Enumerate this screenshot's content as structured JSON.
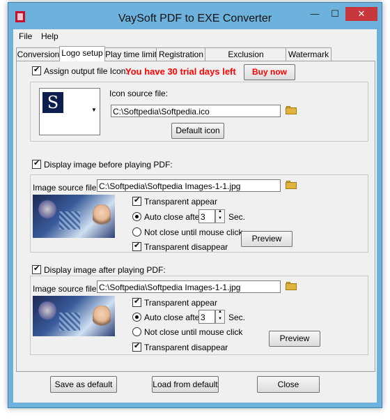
{
  "window": {
    "title": "VaySoft PDF to EXE Converter",
    "minimize": "—",
    "maximize": "☐",
    "close": "✕"
  },
  "menu": [
    "File",
    "Help"
  ],
  "tabs": [
    "Conversion",
    "Logo setup",
    "Play time limit",
    "Registration",
    "Exclusion applications",
    "Watermark"
  ],
  "logo": {
    "assign_icon_label": "Assign output file Icon:",
    "trial_text": "You have 30 trial days left",
    "buy_now": "Buy now",
    "icon_letter": "S",
    "icon_source_label": "Icon source file:",
    "icon_source_value": "C:\\Softpedia\\Softpedia.ico",
    "default_icon": "Default icon",
    "accent_color": "#ff0000"
  },
  "before": {
    "display_label": "Display image before playing PDF:",
    "image_source_label": "Image source file:",
    "image_source_value": "C:\\Softpedia\\Softpedia Images-1-1.jpg",
    "transparent_appear": "Transparent appear",
    "auto_close": "Auto close after",
    "auto_close_value": "3",
    "sec": "Sec.",
    "not_close": "Not close until mouse click",
    "transparent_disappear": "Transparent disappear",
    "preview": "Preview"
  },
  "after": {
    "display_label": "Display image after playing PDF:",
    "image_source_label": "Image source file:",
    "image_source_value": "C:\\Softpedia\\Softpedia Images-1-1.jpg",
    "transparent_appear": "Transparent appear",
    "auto_close": "Auto close after",
    "auto_close_value": "3",
    "sec": "Sec.",
    "not_close": "Not close until mouse click",
    "transparent_disappear": "Transparent disappear",
    "preview": "Preview"
  },
  "footer": {
    "save_default": "Save as default",
    "load_default": "Load from default",
    "close": "Close"
  }
}
